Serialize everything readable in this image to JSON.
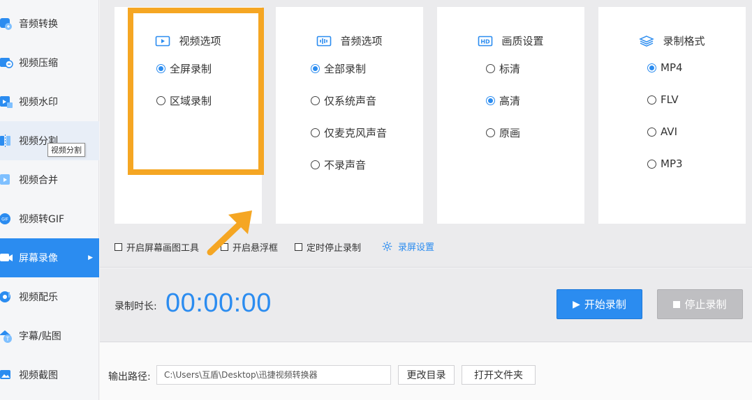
{
  "sidebar": {
    "items": [
      {
        "label": "音频转换",
        "icon": "audio-convert-icon"
      },
      {
        "label": "视频压缩",
        "icon": "video-compress-icon"
      },
      {
        "label": "视频水印",
        "icon": "video-watermark-icon"
      },
      {
        "label": "视频分割",
        "icon": "video-split-icon"
      },
      {
        "label": "视频合并",
        "icon": "video-merge-icon"
      },
      {
        "label": "视频转GIF",
        "icon": "gif-icon"
      },
      {
        "label": "屏幕录像",
        "icon": "screen-record-icon"
      },
      {
        "label": "视频配乐",
        "icon": "video-music-icon"
      },
      {
        "label": "字幕/贴图",
        "icon": "subtitle-icon"
      },
      {
        "label": "视频截图",
        "icon": "screenshot-icon"
      }
    ],
    "active_index": 6,
    "hover_index": 3,
    "tooltip": "视频分割"
  },
  "cards": {
    "video": {
      "title": "视频选项",
      "options": [
        "全屏录制",
        "区域录制"
      ],
      "selected": 0
    },
    "audio": {
      "title": "音频选项",
      "options": [
        "全部录制",
        "仅系统声音",
        "仅麦克风声音",
        "不录声音"
      ],
      "selected": 0
    },
    "quality": {
      "title": "画质设置",
      "options": [
        "标清",
        "高清",
        "原画"
      ],
      "selected": 1
    },
    "format": {
      "title": "录制格式",
      "options": [
        "MP4",
        "FLV",
        "AVI",
        "MP3"
      ],
      "selected": 0
    }
  },
  "checks": {
    "draw_tool": "开启屏幕画图工具",
    "float_window": "开启悬浮框",
    "timed_stop": "定时停止录制",
    "settings": "录屏设置"
  },
  "record": {
    "duration_label": "录制时长:",
    "duration": "00:00:00",
    "start": "开始录制",
    "stop": "停止录制"
  },
  "output": {
    "label": "输出路径:",
    "path": "C:\\Users\\互盾\\Desktop\\迅捷视频转换器",
    "change_dir": "更改目录",
    "open_folder": "打开文件夹"
  },
  "colors": {
    "accent": "#2b8cf0",
    "annotation": "#f5a623",
    "stop_disabled": "#bfbfc2"
  }
}
